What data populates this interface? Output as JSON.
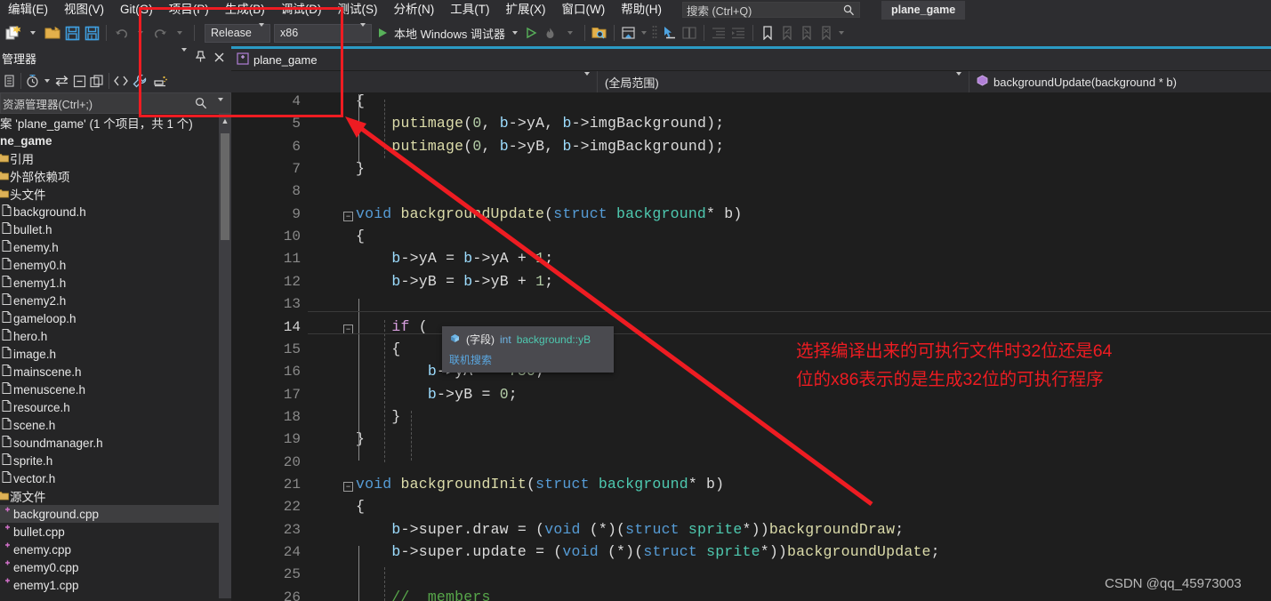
{
  "menubar": {
    "items": [
      {
        "label": "编辑(E)",
        "mnemonic": "E"
      },
      {
        "label": "视图(V)",
        "mnemonic": "V"
      },
      {
        "label": "Git(G)",
        "mnemonic": "G"
      },
      {
        "label": "项目(P)",
        "mnemonic": "P"
      },
      {
        "label": "生成(B)",
        "mnemonic": "B"
      },
      {
        "label": "调试(D)",
        "mnemonic": "D"
      },
      {
        "label": "测试(S)",
        "mnemonic": "S"
      },
      {
        "label": "分析(N)",
        "mnemonic": "N"
      },
      {
        "label": "工具(T)",
        "mnemonic": "T"
      },
      {
        "label": "扩展(X)",
        "mnemonic": "X"
      },
      {
        "label": "窗口(W)",
        "mnemonic": "W"
      },
      {
        "label": "帮助(H)",
        "mnemonic": "H"
      }
    ],
    "search_placeholder": "搜索 (Ctrl+Q)",
    "search_icon": "magnifier-icon",
    "window_tab": "plane_game"
  },
  "toolbar": {
    "new_item_icon": "new-item-icon",
    "open_icon": "open-file-icon",
    "save_icon": "save-icon",
    "save_all_icon": "save-all-icon",
    "undo_icon": "undo-icon",
    "redo_icon": "redo-icon",
    "configuration": {
      "label": "Release",
      "icon": "chevron-down-icon"
    },
    "platform": {
      "label": "x86",
      "icon": "chevron-down-icon"
    },
    "start_debug": {
      "label": "本地 Windows 调试器",
      "icon": "play-icon"
    },
    "run_icon": "run-outline-icon",
    "hot_reload_icon": "hot-reload-icon",
    "search_folder_icon": "search-folder-icon",
    "solution_icon": "solution-home-icon",
    "pointer_icon": "pointer-select-icon",
    "compare_icon": "compare-icon",
    "indent_decrease_icon": "indent-decrease-icon",
    "indent_increase_icon": "indent-increase-icon",
    "bookmark_icon": "bookmark-icon",
    "bookmark_prev_icon": "bookmark-prev-icon",
    "bookmark_next_icon": "bookmark-next-icon",
    "bookmark_clear_icon": "bookmark-clear-icon"
  },
  "solution_explorer": {
    "title": "管理器",
    "dropdown_icon": "chevron-down-icon",
    "pin_icon": "pin-icon",
    "close_icon": "close-icon",
    "tools": {
      "properties_icon": "properties-icon",
      "pending_changes_icon": "pending-changes-icon",
      "sync_icon": "sync-with-active-document-icon",
      "collapse_all_icon": "collapse-all-icon",
      "refresh_icon": "refresh-icon",
      "show_all_files_icon": "show-all-files-icon",
      "properties_window_icon": "wrench-icon",
      "preview_icon": "preview-selected-items-icon"
    },
    "search_placeholder": "资源管理器(Ctrl+;)",
    "search_icon": "magnifier-icon",
    "solution_line": "案 'plane_game' (1 个项目，共 1 个)",
    "project_name": "ne_game",
    "nodes": [
      {
        "label": "引用",
        "icon": "folder-icon",
        "type": "folder",
        "selected": false
      },
      {
        "label": "外部依赖项",
        "icon": "folder-icon",
        "type": "folder",
        "selected": false
      },
      {
        "label": "头文件",
        "icon": "folder-icon",
        "type": "folder",
        "selected": false
      },
      {
        "label": "background.h",
        "icon": "header-file-icon",
        "type": "file",
        "selected": false
      },
      {
        "label": "bullet.h",
        "icon": "header-file-icon",
        "type": "file",
        "selected": false
      },
      {
        "label": "enemy.h",
        "icon": "header-file-icon",
        "type": "file",
        "selected": false
      },
      {
        "label": "enemy0.h",
        "icon": "header-file-icon",
        "type": "file",
        "selected": false
      },
      {
        "label": "enemy1.h",
        "icon": "header-file-icon",
        "type": "file",
        "selected": false
      },
      {
        "label": "enemy2.h",
        "icon": "header-file-icon",
        "type": "file",
        "selected": false
      },
      {
        "label": "gameloop.h",
        "icon": "header-file-icon",
        "type": "file",
        "selected": false
      },
      {
        "label": "hero.h",
        "icon": "header-file-icon",
        "type": "file",
        "selected": false
      },
      {
        "label": "image.h",
        "icon": "header-file-icon",
        "type": "file",
        "selected": false
      },
      {
        "label": "mainscene.h",
        "icon": "header-file-icon",
        "type": "file",
        "selected": false
      },
      {
        "label": "menuscene.h",
        "icon": "header-file-icon",
        "type": "file",
        "selected": false
      },
      {
        "label": "resource.h",
        "icon": "header-file-icon",
        "type": "file",
        "selected": false
      },
      {
        "label": "scene.h",
        "icon": "header-file-icon",
        "type": "file",
        "selected": false
      },
      {
        "label": "soundmanager.h",
        "icon": "header-file-icon",
        "type": "file",
        "selected": false
      },
      {
        "label": "sprite.h",
        "icon": "header-file-icon",
        "type": "file",
        "selected": false
      },
      {
        "label": "vector.h",
        "icon": "header-file-icon",
        "type": "file",
        "selected": false
      },
      {
        "label": "源文件",
        "icon": "folder-icon",
        "type": "folder",
        "selected": false
      },
      {
        "label": "background.cpp",
        "icon": "cpp-file-icon",
        "type": "file",
        "selected": true
      },
      {
        "label": "bullet.cpp",
        "icon": "cpp-file-icon",
        "type": "file",
        "selected": false
      },
      {
        "label": "enemy.cpp",
        "icon": "cpp-file-icon",
        "type": "file",
        "selected": false
      },
      {
        "label": "enemy0.cpp",
        "icon": "cpp-file-icon",
        "type": "file",
        "selected": false
      },
      {
        "label": "enemy1.cpp",
        "icon": "cpp-file-icon",
        "type": "file",
        "selected": false
      }
    ]
  },
  "editor": {
    "tab_label": "plane_game",
    "tab_icon": "project-icon",
    "scope_left": "",
    "scope_left_icon": "chevron-down-icon",
    "scope_middle": "(全局范围)",
    "scope_middle_icon": "chevron-down-icon",
    "scope_right": "backgroundUpdate(background * b)",
    "scope_right_icon": "method-icon",
    "current_line": 14,
    "lines": [
      {
        "num": 4,
        "tokens": [
          {
            "t": "{",
            "c": "p"
          }
        ]
      },
      {
        "num": 5,
        "tokens": [
          {
            "t": "    ",
            "c": "p"
          },
          {
            "t": "putimage",
            "c": "fn"
          },
          {
            "t": "(",
            "c": "p"
          },
          {
            "t": "0",
            "c": "n"
          },
          {
            "t": ", ",
            "c": "p"
          },
          {
            "t": "b",
            "c": "id"
          },
          {
            "t": "->",
            "c": "p"
          },
          {
            "t": "yA",
            "c": "p"
          },
          {
            "t": ", ",
            "c": "p"
          },
          {
            "t": "b",
            "c": "id"
          },
          {
            "t": "->",
            "c": "p"
          },
          {
            "t": "imgBackground",
            "c": "p"
          },
          {
            "t": ");",
            "c": "p"
          }
        ]
      },
      {
        "num": 6,
        "tokens": [
          {
            "t": "    ",
            "c": "p"
          },
          {
            "t": "putimage",
            "c": "fn"
          },
          {
            "t": "(",
            "c": "p"
          },
          {
            "t": "0",
            "c": "n"
          },
          {
            "t": ", ",
            "c": "p"
          },
          {
            "t": "b",
            "c": "id"
          },
          {
            "t": "->",
            "c": "p"
          },
          {
            "t": "yB",
            "c": "p"
          },
          {
            "t": ", ",
            "c": "p"
          },
          {
            "t": "b",
            "c": "id"
          },
          {
            "t": "->",
            "c": "p"
          },
          {
            "t": "imgBackground",
            "c": "p"
          },
          {
            "t": ");",
            "c": "p"
          }
        ]
      },
      {
        "num": 7,
        "tokens": [
          {
            "t": "}",
            "c": "p"
          }
        ]
      },
      {
        "num": 8,
        "tokens": []
      },
      {
        "num": 9,
        "tokens": [
          {
            "t": "void",
            "c": "k"
          },
          {
            "t": " ",
            "c": "p"
          },
          {
            "t": "backgroundUpdate",
            "c": "fn"
          },
          {
            "t": "(",
            "c": "p"
          },
          {
            "t": "struct",
            "c": "k"
          },
          {
            "t": " ",
            "c": "p"
          },
          {
            "t": "background",
            "c": "t"
          },
          {
            "t": "* b)",
            "c": "p"
          }
        ]
      },
      {
        "num": 10,
        "tokens": [
          {
            "t": "{",
            "c": "p"
          }
        ]
      },
      {
        "num": 11,
        "tokens": [
          {
            "t": "    ",
            "c": "p"
          },
          {
            "t": "b",
            "c": "id"
          },
          {
            "t": "->",
            "c": "p"
          },
          {
            "t": "yA",
            "c": "p"
          },
          {
            "t": " = ",
            "c": "p"
          },
          {
            "t": "b",
            "c": "id"
          },
          {
            "t": "->",
            "c": "p"
          },
          {
            "t": "yA",
            "c": "p"
          },
          {
            "t": " + ",
            "c": "p"
          },
          {
            "t": "1",
            "c": "n"
          },
          {
            "t": ";",
            "c": "p"
          }
        ]
      },
      {
        "num": 12,
        "tokens": [
          {
            "t": "    ",
            "c": "p"
          },
          {
            "t": "b",
            "c": "id"
          },
          {
            "t": "->",
            "c": "p"
          },
          {
            "t": "yB",
            "c": "p"
          },
          {
            "t": " = ",
            "c": "p"
          },
          {
            "t": "b",
            "c": "id"
          },
          {
            "t": "->",
            "c": "p"
          },
          {
            "t": "yB",
            "c": "p"
          },
          {
            "t": " + ",
            "c": "p"
          },
          {
            "t": "1",
            "c": "n"
          },
          {
            "t": ";",
            "c": "p"
          }
        ]
      },
      {
        "num": 13,
        "tokens": []
      },
      {
        "num": 14,
        "tokens": [
          {
            "t": "    ",
            "c": "p"
          },
          {
            "t": "if",
            "c": "ctl"
          },
          {
            "t": " (",
            "c": "p"
          }
        ]
      },
      {
        "num": 15,
        "tokens": [
          {
            "t": "    {",
            "c": "p"
          }
        ]
      },
      {
        "num": 16,
        "tokens": [
          {
            "t": "        ",
            "c": "p"
          },
          {
            "t": "b",
            "c": "id"
          },
          {
            "t": "->",
            "c": "p"
          },
          {
            "t": "yA",
            "c": "p"
          },
          {
            "t": " = ",
            "c": "p"
          },
          {
            "t": "-750",
            "c": "n"
          },
          {
            "t": ";",
            "c": "p"
          }
        ]
      },
      {
        "num": 17,
        "tokens": [
          {
            "t": "        ",
            "c": "p"
          },
          {
            "t": "b",
            "c": "id"
          },
          {
            "t": "->",
            "c": "p"
          },
          {
            "t": "yB",
            "c": "p"
          },
          {
            "t": " = ",
            "c": "p"
          },
          {
            "t": "0",
            "c": "n"
          },
          {
            "t": ";",
            "c": "p"
          }
        ]
      },
      {
        "num": 18,
        "tokens": [
          {
            "t": "    }",
            "c": "p"
          }
        ]
      },
      {
        "num": 19,
        "tokens": [
          {
            "t": "}",
            "c": "p"
          }
        ]
      },
      {
        "num": 20,
        "tokens": []
      },
      {
        "num": 21,
        "tokens": [
          {
            "t": "void",
            "c": "k"
          },
          {
            "t": " ",
            "c": "p"
          },
          {
            "t": "backgroundInit",
            "c": "fn"
          },
          {
            "t": "(",
            "c": "p"
          },
          {
            "t": "struct",
            "c": "k"
          },
          {
            "t": " ",
            "c": "p"
          },
          {
            "t": "background",
            "c": "t"
          },
          {
            "t": "* b)",
            "c": "p"
          }
        ]
      },
      {
        "num": 22,
        "tokens": [
          {
            "t": "{",
            "c": "p"
          }
        ]
      },
      {
        "num": 23,
        "tokens": [
          {
            "t": "    ",
            "c": "p"
          },
          {
            "t": "b",
            "c": "id"
          },
          {
            "t": "->",
            "c": "p"
          },
          {
            "t": "super",
            "c": "p"
          },
          {
            "t": ".",
            "c": "p"
          },
          {
            "t": "draw",
            "c": "p"
          },
          {
            "t": " = (",
            "c": "p"
          },
          {
            "t": "void",
            "c": "k"
          },
          {
            "t": " (*)(",
            "c": "p"
          },
          {
            "t": "struct",
            "c": "k"
          },
          {
            "t": " ",
            "c": "p"
          },
          {
            "t": "sprite",
            "c": "t"
          },
          {
            "t": "*))",
            "c": "p"
          },
          {
            "t": "backgroundDraw",
            "c": "fn"
          },
          {
            "t": ";",
            "c": "p"
          }
        ]
      },
      {
        "num": 24,
        "tokens": [
          {
            "t": "    ",
            "c": "p"
          },
          {
            "t": "b",
            "c": "id"
          },
          {
            "t": "->",
            "c": "p"
          },
          {
            "t": "super",
            "c": "p"
          },
          {
            "t": ".",
            "c": "p"
          },
          {
            "t": "update",
            "c": "p"
          },
          {
            "t": " = (",
            "c": "p"
          },
          {
            "t": "void",
            "c": "k"
          },
          {
            "t": " (*)(",
            "c": "p"
          },
          {
            "t": "struct",
            "c": "k"
          },
          {
            "t": " ",
            "c": "p"
          },
          {
            "t": "sprite",
            "c": "t"
          },
          {
            "t": "*))",
            "c": "p"
          },
          {
            "t": "backgroundUpdate",
            "c": "fn"
          },
          {
            "t": ";",
            "c": "p"
          }
        ]
      },
      {
        "num": 25,
        "tokens": []
      },
      {
        "num": 26,
        "tokens": [
          {
            "t": "    ",
            "c": "p"
          },
          {
            "t": "//  members",
            "c": "c"
          }
        ]
      }
    ],
    "fold_lines": [
      9,
      14,
      21
    ],
    "tooltip": {
      "icon": "field-icon",
      "kind": "(字段)",
      "return_type": "int",
      "signature": "background::yB",
      "link": "联机搜索"
    }
  },
  "annotations": {
    "accent_color": "#ee1c22",
    "callout_line1": "选择编译出来的可执行文件时32位还是64",
    "callout_line2": "位的x86表示的是生成32位的可执行程序",
    "arrow_icon": "arrow-pointer-icon",
    "highlight_box_icon": "red-highlight-box"
  },
  "watermark": "CSDN @qq_45973003"
}
